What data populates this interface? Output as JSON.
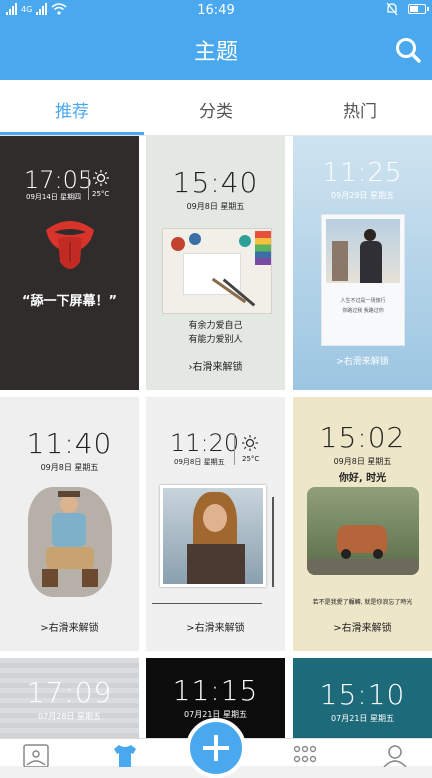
{
  "status": {
    "network": "4G",
    "time": "16:49"
  },
  "header": {
    "title": "主题"
  },
  "tabs": [
    {
      "label": "推荐"
    },
    {
      "label": "分类"
    },
    {
      "label": "热门"
    }
  ],
  "themes": [
    {
      "time": "17:05",
      "date": "09月14日  星期四",
      "temp": "25°C",
      "slogan": "“舔一下屏幕！”"
    },
    {
      "time": "15:40",
      "date": "09月8日  星期五",
      "caption1": "有余力爱自己",
      "caption2": "有能力爱别人",
      "swipe": "›右滑来解锁"
    },
    {
      "time": "11:25",
      "date": "09月29日  星期五",
      "caption1": "人生不过是一场旅行",
      "caption2": "你路过我 我路过你",
      "swipe": ">右滑来解锁"
    },
    {
      "time": "11:40",
      "date": "09月8日  星期五",
      "swipe": ">右滑来解锁"
    },
    {
      "time": "11:20",
      "date": "09月8日  星期五",
      "temp": "25°C",
      "swipe": ">右滑来解锁"
    },
    {
      "time": "15:02",
      "date": "09月8日  星期五",
      "caption1": "你好, 时光",
      "caption2": "若不是我愛了輾轉, 就是你浪忘了時光",
      "swipe": ">右滑来解锁"
    },
    {
      "time": "17:09",
      "date": "07月28日  星期五"
    },
    {
      "time": "11:15",
      "date": "07月21日  星期五"
    },
    {
      "time": "15:10",
      "date": "07月21日  星期五"
    }
  ],
  "colors": {
    "accent": "#4aa8ee"
  },
  "bottomnav": [
    "wallpaper-icon",
    "theme-shirt-icon",
    "add-icon",
    "more-apps-icon",
    "profile-icon"
  ]
}
